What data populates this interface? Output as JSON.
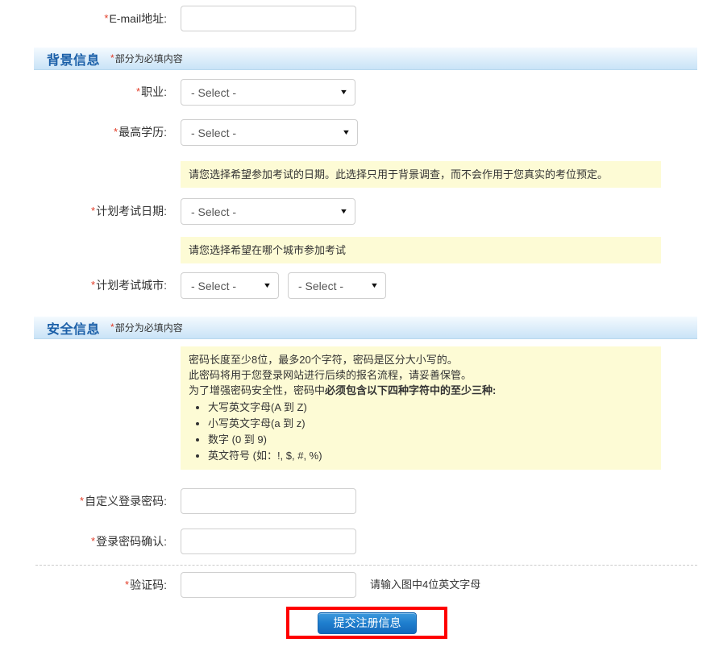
{
  "colors": {
    "required_star": "#e23b26",
    "section_title": "#1a5fa8",
    "section_bar_top": "#f4fafe",
    "section_bar_bottom": "#c9e3f7",
    "hint_background": "#fdfbd5",
    "submit_button": "#1f7fce",
    "annotation_box": "#ff0000"
  },
  "fields": {
    "email": {
      "label": "E-mail地址:",
      "required": true,
      "value": "",
      "placeholder": ""
    },
    "occupation": {
      "label": "职业:",
      "required": true,
      "value": "- Select -"
    },
    "education": {
      "label": "最高学历:",
      "required": true,
      "value": "- Select -"
    },
    "exam_date": {
      "label": "计划考试日期:",
      "required": true,
      "value": "- Select -"
    },
    "exam_city_province": {
      "label": "计划考试城市:",
      "required": true,
      "value": "- Select -"
    },
    "exam_city_city": {
      "value": "- Select -"
    },
    "password": {
      "label": "自定义登录密码:",
      "required": true,
      "value": "",
      "placeholder": ""
    },
    "password_confirm": {
      "label": "登录密码确认:",
      "required": true,
      "value": "",
      "placeholder": ""
    },
    "captcha": {
      "label": "验证码:",
      "required": true,
      "value": "",
      "placeholder": "",
      "sidenote": "请输入图中4位英文字母"
    }
  },
  "sections": {
    "background": {
      "title": "背景信息",
      "note": "部分为必填内容",
      "star": "*"
    },
    "security": {
      "title": "安全信息",
      "note": "部分为必填内容",
      "star": "*"
    }
  },
  "hints": {
    "exam_date": "请您选择希望参加考试的日期。此选择只用于背景调查，而不会作用于您真实的考位预定。",
    "exam_city": "请您选择希望在哪个城市参加考试",
    "password": {
      "line1": "密码长度至少8位，最多20个字符，密码是区分大小写的。",
      "line2": "此密码将用于您登录网站进行后续的报名流程，请妥善保管。",
      "line3_prefix": "为了增强密码安全性，密码中",
      "line3_bold": "必须包含以下四种字符中的至少三种:",
      "bullets": [
        "大写英文字母(A 到 Z)",
        "小写英文字母(a 到 z)",
        "数字 (0 到 9)",
        "英文符号 (如：!, $, #, %)"
      ]
    }
  },
  "submit": {
    "label": "提交注册信息"
  },
  "icons": {
    "caret_down": "▼"
  }
}
